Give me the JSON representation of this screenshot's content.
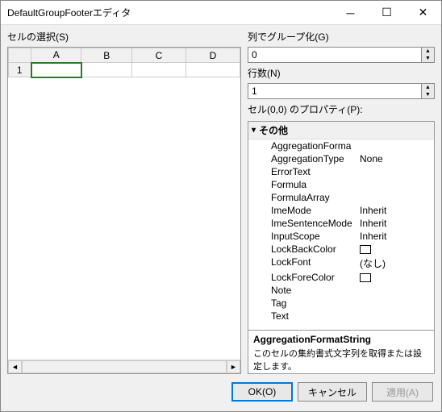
{
  "titlebar": {
    "title": "DefaultGroupFooterエディタ"
  },
  "left": {
    "label": "セルの選択(S)",
    "columns": [
      "A",
      "B",
      "C",
      "D"
    ],
    "rows": [
      "1"
    ]
  },
  "right": {
    "group_label": "列でグループ化(G)",
    "group_value": "0",
    "rows_label": "行数(N)",
    "rows_value": "1",
    "props_label": "セル(0,0) のプロパティ(P):",
    "category": "その他",
    "props": [
      {
        "name": "AggregationFormatString",
        "display": "AggregationForma",
        "val": ""
      },
      {
        "name": "AggregationType",
        "display": "AggregationType",
        "val": "None"
      },
      {
        "name": "ErrorText",
        "display": "ErrorText",
        "val": ""
      },
      {
        "name": "Formula",
        "display": "Formula",
        "val": ""
      },
      {
        "name": "FormulaArray",
        "display": "FormulaArray",
        "val": ""
      },
      {
        "name": "ImeMode",
        "display": "ImeMode",
        "val": "Inherit"
      },
      {
        "name": "ImeSentenceMode",
        "display": "ImeSentenceMode",
        "val": "Inherit"
      },
      {
        "name": "InputScope",
        "display": "InputScope",
        "val": "Inherit"
      },
      {
        "name": "LockBackColor",
        "display": "LockBackColor",
        "val": "[color]"
      },
      {
        "name": "LockFont",
        "display": "LockFont",
        "val": "(なし)"
      },
      {
        "name": "LockForeColor",
        "display": "LockForeColor",
        "val": "[color]"
      },
      {
        "name": "Note",
        "display": "Note",
        "val": ""
      },
      {
        "name": "Tag",
        "display": "Tag",
        "val": ""
      },
      {
        "name": "Text",
        "display": "Text",
        "val": ""
      }
    ],
    "desc_title": "AggregationFormatString",
    "desc_text": "このセルの集約書式文字列を取得または設定します。"
  },
  "buttons": {
    "ok": "OK(O)",
    "cancel": "キャンセル",
    "apply": "適用(A)"
  }
}
